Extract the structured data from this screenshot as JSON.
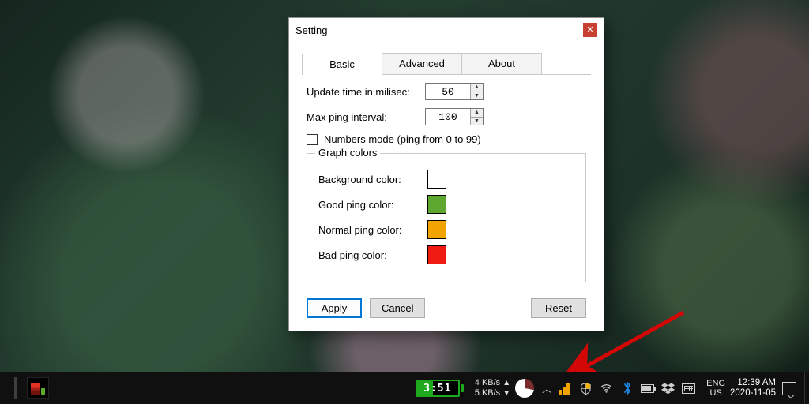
{
  "dialog": {
    "title": "Setting",
    "tabs": {
      "basic": "Basic",
      "advanced": "Advanced",
      "about": "About"
    },
    "update_label": "Update time in milisec:",
    "update_value": "50",
    "maxping_label": "Max ping interval:",
    "maxping_value": "100",
    "numbers_label": "Numbers mode (ping from 0 to 99)",
    "group_title": "Graph colors",
    "colors": {
      "bg_label": "Background color:",
      "bg_value": "#ffffff",
      "good_label": "Good ping color:",
      "good_value": "#5fa82f",
      "normal_label": "Normal ping color:",
      "normal_value": "#f2a500",
      "bad_label": "Bad ping color:",
      "bad_value": "#ef1a10"
    },
    "buttons": {
      "apply": "Apply",
      "cancel": "Cancel",
      "reset": "Reset"
    }
  },
  "taskbar": {
    "battery_time": "3:51",
    "net_up": "4 KB/s",
    "net_down": "5 KB/s",
    "lang_top": "ENG",
    "lang_bottom": "US",
    "clock_time": "12:39 AM",
    "clock_date": "2020-11-05"
  }
}
